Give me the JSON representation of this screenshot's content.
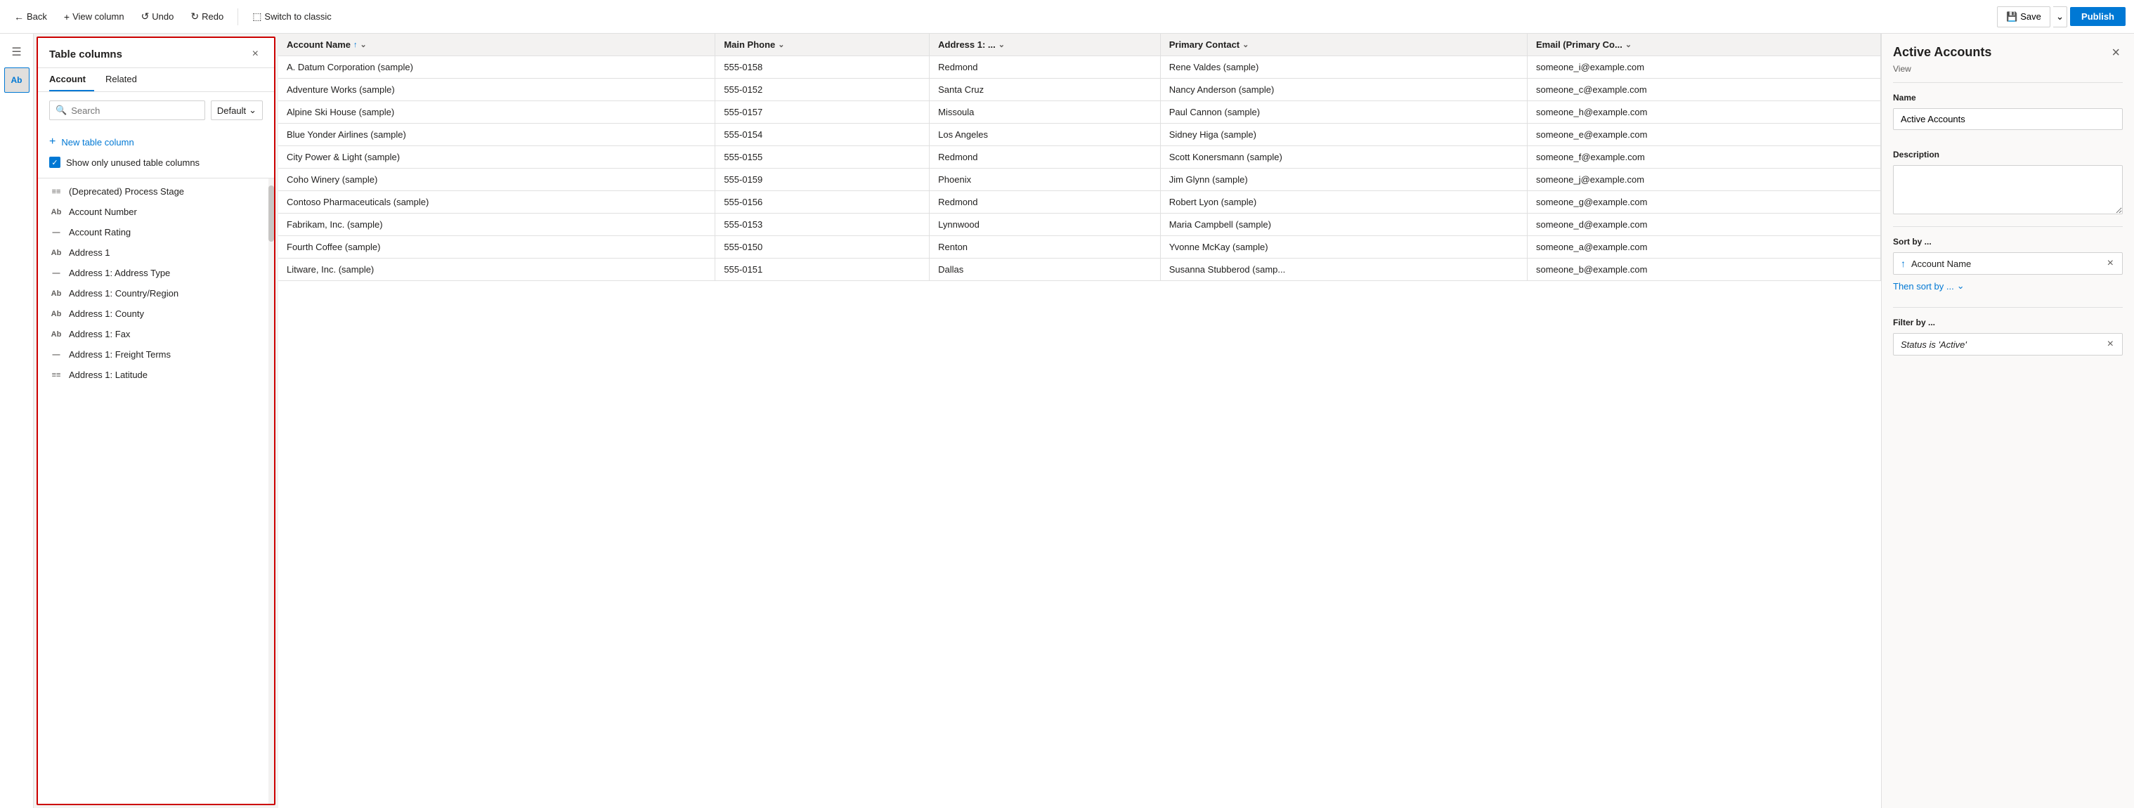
{
  "toolbar": {
    "back_label": "Back",
    "view_column_label": "View column",
    "undo_label": "Undo",
    "redo_label": "Redo",
    "switch_label": "Switch to classic",
    "save_label": "Save",
    "publish_label": "Publish"
  },
  "columns_panel": {
    "title": "Table columns",
    "close_icon": "×",
    "tabs": [
      {
        "label": "Account",
        "active": true
      },
      {
        "label": "Related",
        "active": false
      }
    ],
    "search": {
      "placeholder": "Search",
      "default_label": "Default"
    },
    "new_column_label": "New table column",
    "show_unused_label": "Show only unused table columns",
    "columns": [
      {
        "icon": "≡≡",
        "label": "(Deprecated) Process Stage"
      },
      {
        "icon": "Ab",
        "label": "Account Number"
      },
      {
        "icon": "—",
        "label": "Account Rating"
      },
      {
        "icon": "Ab",
        "label": "Address 1"
      },
      {
        "icon": "—",
        "label": "Address 1: Address Type"
      },
      {
        "icon": "Ab",
        "label": "Address 1: Country/Region"
      },
      {
        "icon": "Ab",
        "label": "Address 1: County"
      },
      {
        "icon": "Ab",
        "label": "Address 1: Fax"
      },
      {
        "icon": "—",
        "label": "Address 1: Freight Terms"
      },
      {
        "icon": "≡≡",
        "label": "Address 1: Latitude"
      }
    ]
  },
  "grid": {
    "columns": [
      {
        "label": "Account Name",
        "sort": "↑",
        "filter": "⌄"
      },
      {
        "label": "Main Phone",
        "sort": "",
        "filter": "⌄"
      },
      {
        "label": "Address 1: ...",
        "sort": "",
        "filter": "⌄"
      },
      {
        "label": "Primary Contact",
        "sort": "",
        "filter": "⌄"
      },
      {
        "label": "Email (Primary Co...",
        "sort": "",
        "filter": "⌄"
      }
    ],
    "rows": [
      {
        "name": "A. Datum Corporation (sample)",
        "phone": "555-0158",
        "address": "Redmond",
        "contact": "Rene Valdes (sample)",
        "email": "someone_i@example.com"
      },
      {
        "name": "Adventure Works (sample)",
        "phone": "555-0152",
        "address": "Santa Cruz",
        "contact": "Nancy Anderson (sample)",
        "email": "someone_c@example.com"
      },
      {
        "name": "Alpine Ski House (sample)",
        "phone": "555-0157",
        "address": "Missoula",
        "contact": "Paul Cannon (sample)",
        "email": "someone_h@example.com"
      },
      {
        "name": "Blue Yonder Airlines (sample)",
        "phone": "555-0154",
        "address": "Los Angeles",
        "contact": "Sidney Higa (sample)",
        "email": "someone_e@example.com"
      },
      {
        "name": "City Power & Light (sample)",
        "phone": "555-0155",
        "address": "Redmond",
        "contact": "Scott Konersmann (sample)",
        "email": "someone_f@example.com"
      },
      {
        "name": "Coho Winery (sample)",
        "phone": "555-0159",
        "address": "Phoenix",
        "contact": "Jim Glynn (sample)",
        "email": "someone_j@example.com"
      },
      {
        "name": "Contoso Pharmaceuticals (sample)",
        "phone": "555-0156",
        "address": "Redmond",
        "contact": "Robert Lyon (sample)",
        "email": "someone_g@example.com"
      },
      {
        "name": "Fabrikam, Inc. (sample)",
        "phone": "555-0153",
        "address": "Lynnwood",
        "contact": "Maria Campbell (sample)",
        "email": "someone_d@example.com"
      },
      {
        "name": "Fourth Coffee (sample)",
        "phone": "555-0150",
        "address": "Renton",
        "contact": "Yvonne McKay (sample)",
        "email": "someone_a@example.com"
      },
      {
        "name": "Litware, Inc. (sample)",
        "phone": "555-0151",
        "address": "Dallas",
        "contact": "Susanna Stubberod (samp...",
        "email": "someone_b@example.com"
      }
    ]
  },
  "right_panel": {
    "title": "Active Accounts",
    "subtitle": "View",
    "close_icon": "×",
    "name_label": "Name",
    "name_value": "Active Accounts",
    "description_label": "Description",
    "description_value": "",
    "sort_label": "Sort by ...",
    "sort_field": "Account Name",
    "sort_up_icon": "↑",
    "sort_remove_icon": "×",
    "then_sort_label": "Then sort by ...",
    "then_sort_icon": "⌄",
    "filter_label": "Filter by ...",
    "filter_value": "Status is 'Active'",
    "filter_remove_icon": "×"
  },
  "icon_rail": {
    "icons": [
      {
        "name": "hamburger-icon",
        "glyph": "☰"
      },
      {
        "name": "text-icon",
        "glyph": "A"
      }
    ]
  }
}
